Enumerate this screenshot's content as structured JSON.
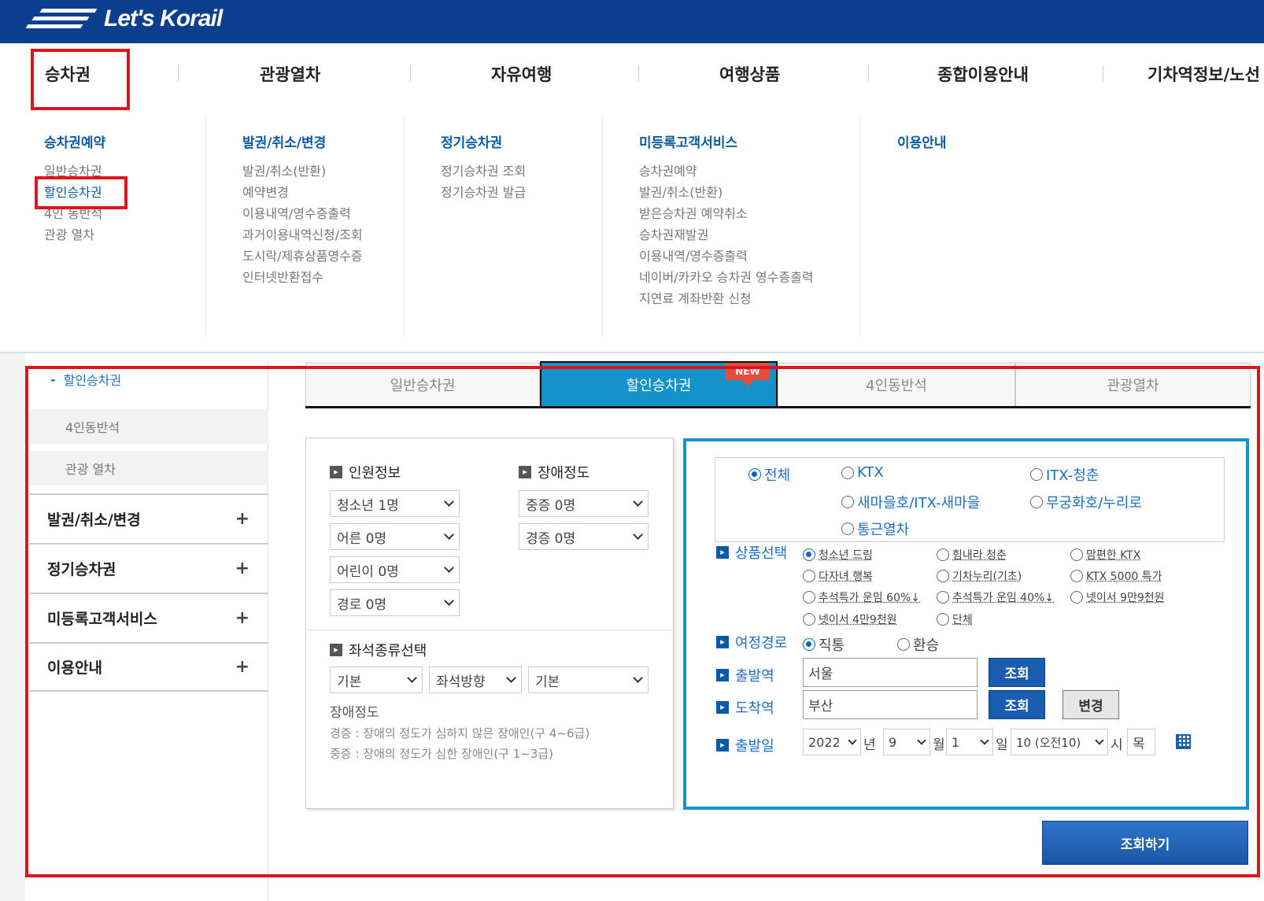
{
  "header": {
    "logo_text": "Let's Korail"
  },
  "gnb": {
    "items": [
      "승차권",
      "관광열차",
      "자유여행",
      "여행상품",
      "종합이용안내",
      "기차역정보/노선"
    ]
  },
  "mega": {
    "col1": {
      "head": "승차권예약",
      "items": [
        "일반승차권",
        "할인승차권",
        "4인 동반석",
        "관광 열차"
      ]
    },
    "col2": {
      "head": "발권/취소/변경",
      "items": [
        "발권/취소(반환)",
        "예약변경",
        "이용내역/영수증출력",
        "과거이용내역신청/조회",
        "도시락/제휴상품영수증",
        "인터넷반환접수"
      ]
    },
    "col3": {
      "head": "정기승차권",
      "items": [
        "정기승차권 조회",
        "정기승차권 발급"
      ]
    },
    "col4": {
      "head": "미등록고객서비스",
      "items": [
        "승차권예약",
        "발권/취소(반환)",
        "받은승차권 예약취소",
        "승차권재발권",
        "이용내역/영수증출력",
        "네이버/카카오 승차권 영수증출력",
        "지연료 계좌반환 신청"
      ]
    },
    "col5": {
      "head": "이용안내"
    }
  },
  "lnb": {
    "active_sub": "할인승차권",
    "active_prefix": "-",
    "subs": [
      "4인동반석",
      "관광 열차"
    ],
    "mains": [
      "발권/취소/변경",
      "정기승차권",
      "미등록고객서비스",
      "이용안내"
    ],
    "plus": "+"
  },
  "tabs": {
    "items": [
      "일반승차권",
      "할인승차권",
      "4인동반석",
      "관광열차"
    ],
    "new_badge": "NEW"
  },
  "passenger": {
    "title": "인원정보",
    "selects": [
      "청소년 1명",
      "어른 0명",
      "어린이 0명",
      "경로 0명"
    ],
    "disability_title": "장애정도",
    "disability_selects": [
      "중증 0명",
      "경증 0명"
    ],
    "seat_title": "좌석종류선택",
    "seat_selects": [
      "기본",
      "좌석방향",
      "기본"
    ],
    "note_title": "장애정도",
    "note_lines": [
      "경증 : 장애의 정도가 심하지 않은 장애인(구 4~6급)",
      "중증 : 장애의 정도가 심한 장애인(구 1~3급)"
    ]
  },
  "train_types": [
    "전체",
    "KTX",
    "ITX-청춘",
    "새마을호/ITX-새마을",
    "무궁화호/누리로",
    "통근열차"
  ],
  "product": {
    "label": "상품선택",
    "options": [
      "청소년 드림",
      "힘내라 청춘",
      "맘편한 KTX",
      "다자녀 행복",
      "기차누리(기초)",
      "KTX 5000 특가",
      "추석특가 운임 60%↓",
      "추석특가 운임 40%↓",
      "넷이서 9만9천원",
      "넷이서 4만9천원",
      "단체"
    ]
  },
  "route": {
    "label": "여정경로",
    "options": [
      "직통",
      "환승"
    ]
  },
  "departure": {
    "label": "출발역",
    "value": "서울",
    "button": "조회"
  },
  "arrival": {
    "label": "도착역",
    "value": "부산",
    "button": "조회",
    "swap": "변경"
  },
  "date": {
    "label": "출발일",
    "year": "2022",
    "year_unit": "년",
    "month": "9",
    "month_unit": "월",
    "day": "1",
    "day_unit": "일",
    "hour": "10 (오전10)",
    "hour_unit": "시",
    "weekday": "목"
  },
  "search_button": "조회하기",
  "colors": {
    "brand_navy": "#0b3e8e",
    "accent_blue": "#1592c9",
    "highlight_red": "#e0141c"
  }
}
